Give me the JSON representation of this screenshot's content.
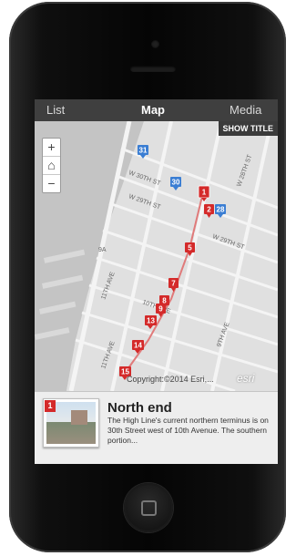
{
  "tabs": {
    "list": "List",
    "map": "Map",
    "media": "Media"
  },
  "map": {
    "show_title_button": "SHOW TITLE",
    "zoom": {
      "in": "+",
      "home": "⌂",
      "out": "−"
    },
    "copyright": "Copyright:©2014 Esri,...",
    "logo": "esri",
    "street_labels": [
      "W 30TH ST",
      "W 29TH ST",
      "W 29TH ST",
      "11TH AVE",
      "11TH AVE",
      "10TH AVE",
      "9TH AVE",
      "9A",
      "W 28TH ST"
    ],
    "markers": [
      "1",
      "2",
      "5",
      "7",
      "8",
      "9",
      "13",
      "14",
      "15"
    ],
    "blue_markers": [
      "31",
      "30",
      "28"
    ]
  },
  "card": {
    "badge": "1",
    "title": "North end",
    "description": "The High Line's current northern terminus is on 30th Street west of 10th Avenue. The southern portion..."
  },
  "colors": {
    "marker_red": "#d42a2a",
    "marker_blue": "#3b7ed3",
    "tab_bar": "#3f3f3f"
  }
}
